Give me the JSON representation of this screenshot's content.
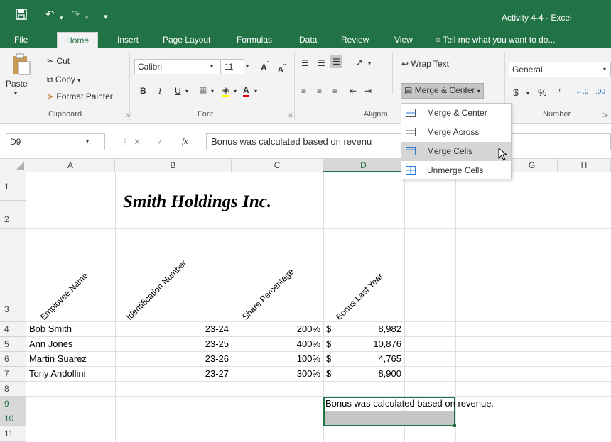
{
  "window": {
    "title": "Activity 4-4 - Excel",
    "save_icon": "save-icon",
    "undo_icon": "undo-icon",
    "redo_icon": "redo-icon"
  },
  "tabs": [
    "File",
    "Home",
    "Insert",
    "Page Layout",
    "Formulas",
    "Data",
    "Review",
    "View"
  ],
  "active_tab": "Home",
  "tell_me": "Tell me what you want to do...",
  "ribbon": {
    "clipboard": {
      "paste": "Paste",
      "cut": "Cut",
      "copy": "Copy",
      "format_painter": "Format Painter",
      "label": "Clipboard"
    },
    "font": {
      "name": "Calibri",
      "size": "11",
      "bold": "B",
      "italic": "I",
      "underline": "U",
      "label": "Font"
    },
    "alignment": {
      "wrap_text": "Wrap Text",
      "merge_center": "Merge & Center",
      "label": "Alignm"
    },
    "number": {
      "format": "General",
      "currency": "$",
      "percent": "%",
      "comma": "’",
      "inc_dec": ".00",
      "label": "Number"
    }
  },
  "merge_menu": [
    {
      "label": "Merge & Center",
      "icon": "merge-center-icon"
    },
    {
      "label": "Merge Across",
      "icon": "merge-across-icon"
    },
    {
      "label": "Merge Cells",
      "icon": "merge-cells-icon",
      "highlighted": true
    },
    {
      "label": "Unmerge Cells",
      "icon": "unmerge-cells-icon"
    }
  ],
  "formula_bar": {
    "name_box": "D9",
    "cancel": "✕",
    "enter": "✓",
    "fx": "fx",
    "content": "Bonus was calculated based on revenu"
  },
  "sheet": {
    "columns": [
      "A",
      "B",
      "C",
      "D",
      "E",
      "F",
      "G",
      "H"
    ],
    "selected_column": "D",
    "rows": [
      "1",
      "2",
      "3",
      "4",
      "5",
      "6",
      "7",
      "8",
      "9",
      "10",
      "11"
    ],
    "title": "Smith Holdings Inc.",
    "headers": [
      "Employee Name",
      "Identification Number",
      "Share Percentage",
      "Bonus Last Year"
    ],
    "data": [
      {
        "name": "Bob Smith",
        "id": "23-24",
        "share": "200%",
        "currency": "$",
        "bonus": "8,982"
      },
      {
        "name": "Ann Jones",
        "id": "23-25",
        "share": "400%",
        "currency": "$",
        "bonus": "10,876"
      },
      {
        "name": "Martin Suarez",
        "id": "23-26",
        "share": "100%",
        "currency": "$",
        "bonus": "4,765"
      },
      {
        "name": "Tony Andollini",
        "id": "23-27",
        "share": "300%",
        "currency": "$",
        "bonus": "8,900"
      }
    ],
    "note": "Bonus was calculated based on revenue."
  },
  "colors": {
    "brand": "#217346",
    "selection": "#c6c6c6",
    "menu_hover": "#d6d6d6"
  }
}
